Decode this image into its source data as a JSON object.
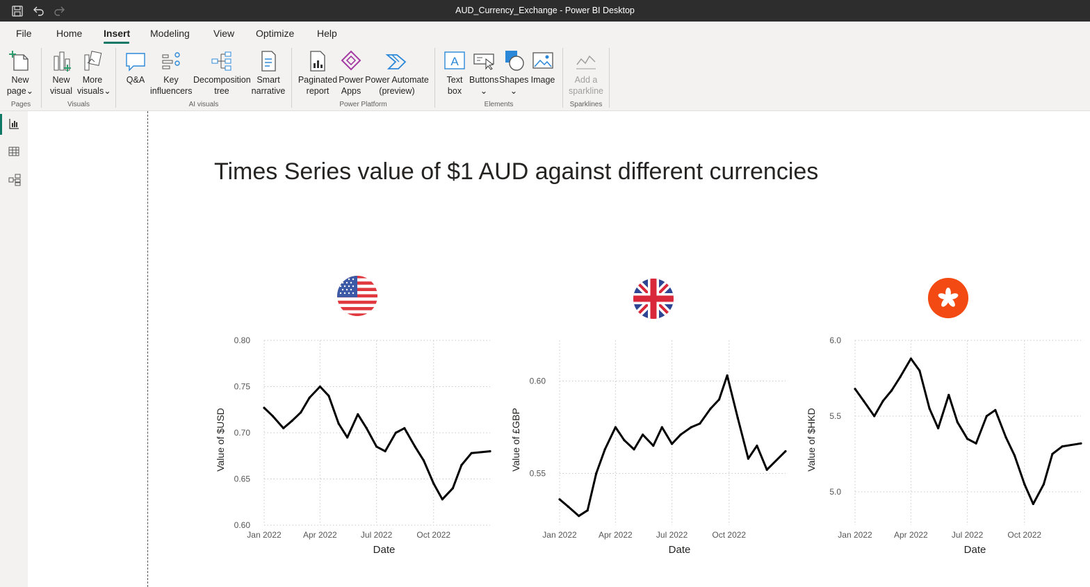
{
  "window": {
    "title": "AUD_Currency_Exchange - Power BI Desktop"
  },
  "menu": {
    "tabs": [
      "File",
      "Home",
      "Insert",
      "Modeling",
      "View",
      "Optimize",
      "Help"
    ],
    "active": "Insert"
  },
  "ribbon": {
    "groups": {
      "pages": "Pages",
      "visuals": "Visuals",
      "ai_visuals": "AI visuals",
      "power_platform": "Power Platform",
      "elements": "Elements",
      "sparklines": "Sparklines"
    },
    "buttons": {
      "new_page": [
        "New",
        "page"
      ],
      "new_visual": [
        "New",
        "visual"
      ],
      "more_visuals": [
        "More",
        "visuals"
      ],
      "qna": [
        "Q&A"
      ],
      "key_influencers": [
        "Key",
        "influencers"
      ],
      "decomposition_tree": [
        "Decomposition",
        "tree"
      ],
      "smart_narrative": [
        "Smart",
        "narrative"
      ],
      "paginated_report": [
        "Paginated",
        "report"
      ],
      "power_apps": [
        "Power",
        "Apps"
      ],
      "power_automate": [
        "Power Automate",
        "(preview)"
      ],
      "text_box": [
        "Text",
        "box"
      ],
      "buttons": [
        "Buttons"
      ],
      "shapes": [
        "Shapes"
      ],
      "image": [
        "Image"
      ],
      "add_sparkline": [
        "Add a",
        "sparkline"
      ]
    },
    "accent_color": "#117865"
  },
  "report": {
    "title": "Times Series value of $1 AUD against different currencies"
  },
  "chart_data": [
    {
      "type": "line",
      "xlabel": "Date",
      "ylabel": "Value of $USD",
      "x_ticks": [
        "Jan 2022",
        "Apr 2022",
        "Jul 2022",
        "Oct 2022"
      ],
      "y_ticks": [
        "0.60",
        "0.65",
        "0.70",
        "0.75",
        "0.80"
      ],
      "ylim": [
        0.6,
        0.8
      ],
      "series": [
        {
          "x": [
            "2022-01-01",
            "2022-01-15",
            "2022-02-01",
            "2022-02-15",
            "2022-03-01",
            "2022-03-15",
            "2022-04-01",
            "2022-04-15",
            "2022-05-01",
            "2022-05-15",
            "2022-06-01",
            "2022-06-15",
            "2022-07-01",
            "2022-07-15",
            "2022-08-01",
            "2022-08-15",
            "2022-09-01",
            "2022-09-15",
            "2022-10-01",
            "2022-10-15",
            "2022-11-01",
            "2022-11-15",
            "2022-12-01",
            "2022-12-31"
          ],
          "values": [
            0.727,
            0.718,
            0.705,
            0.713,
            0.722,
            0.738,
            0.75,
            0.74,
            0.71,
            0.695,
            0.72,
            0.705,
            0.685,
            0.68,
            0.7,
            0.705,
            0.685,
            0.67,
            0.645,
            0.628,
            0.64,
            0.665,
            0.678,
            0.68
          ]
        }
      ],
      "flag": "us-flag-icon",
      "grid": true
    },
    {
      "type": "line",
      "xlabel": "Date",
      "ylabel": "Value of £GBP",
      "x_ticks": [
        "Jan 2022",
        "Apr 2022",
        "Jul 2022",
        "Oct 2022"
      ],
      "y_ticks": [
        "0.55",
        "0.60"
      ],
      "ylim": [
        0.522,
        0.622
      ],
      "series": [
        {
          "x": [
            "2022-01-01",
            "2022-01-15",
            "2022-02-01",
            "2022-02-15",
            "2022-03-01",
            "2022-03-15",
            "2022-04-01",
            "2022-04-15",
            "2022-05-01",
            "2022-05-15",
            "2022-06-01",
            "2022-06-15",
            "2022-07-01",
            "2022-07-15",
            "2022-08-01",
            "2022-08-15",
            "2022-09-01",
            "2022-09-15",
            "2022-09-28",
            "2022-10-15",
            "2022-11-01",
            "2022-11-15",
            "2022-12-01",
            "2022-12-31"
          ],
          "values": [
            0.536,
            0.532,
            0.527,
            0.53,
            0.55,
            0.563,
            0.575,
            0.568,
            0.563,
            0.571,
            0.565,
            0.575,
            0.566,
            0.571,
            0.575,
            0.577,
            0.585,
            0.59,
            0.603,
            0.58,
            0.558,
            0.565,
            0.552,
            0.562
          ]
        }
      ],
      "flag": "uk-flag-icon",
      "grid": true
    },
    {
      "type": "line",
      "xlabel": "Date",
      "ylabel": "Value of $HKD",
      "x_ticks": [
        "Jan 2022",
        "Apr 2022",
        "Jul 2022",
        "Oct 2022"
      ],
      "y_ticks": [
        "5.0",
        "5.5",
        "6.0"
      ],
      "ylim": [
        4.78,
        6.0
      ],
      "series": [
        {
          "x": [
            "2022-01-01",
            "2022-01-15",
            "2022-02-01",
            "2022-02-15",
            "2022-03-01",
            "2022-03-15",
            "2022-04-01",
            "2022-04-15",
            "2022-05-01",
            "2022-05-15",
            "2022-06-01",
            "2022-06-15",
            "2022-07-01",
            "2022-07-15",
            "2022-08-01",
            "2022-08-15",
            "2022-09-01",
            "2022-09-15",
            "2022-10-01",
            "2022-10-15",
            "2022-11-01",
            "2022-11-15",
            "2022-12-01",
            "2022-12-31"
          ],
          "values": [
            5.68,
            5.6,
            5.5,
            5.6,
            5.67,
            5.76,
            5.88,
            5.8,
            5.55,
            5.42,
            5.64,
            5.46,
            5.35,
            5.32,
            5.5,
            5.54,
            5.36,
            5.24,
            5.05,
            4.92,
            5.05,
            5.25,
            5.3,
            5.32
          ]
        }
      ],
      "flag": "hk-flag-icon",
      "grid": true
    }
  ]
}
